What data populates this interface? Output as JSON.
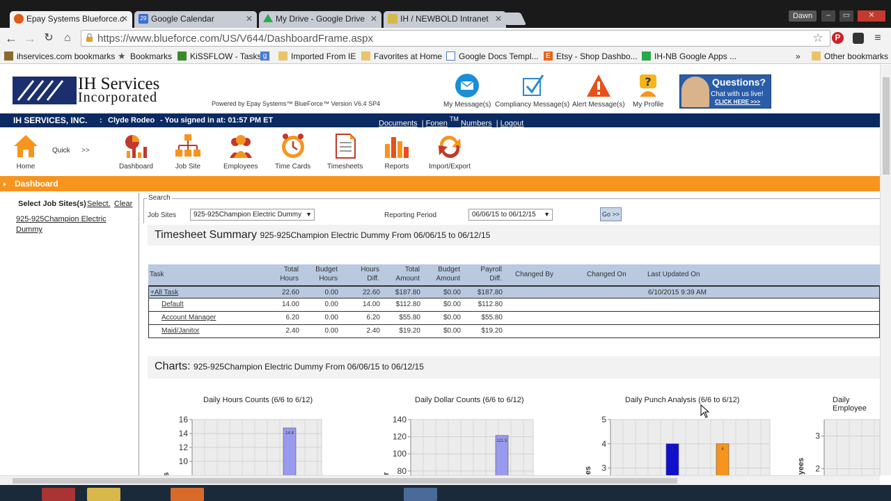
{
  "browser": {
    "tabs": [
      {
        "title": "Epay Systems Blueforce.c",
        "active": true,
        "favicon_color": "#e05a1c"
      },
      {
        "title": "Google Calendar",
        "active": false,
        "favicon_color": "#3b6fd6",
        "favicon_text": "29"
      },
      {
        "title": "My Drive - Google Drive",
        "active": false,
        "favicon_color": "#2aa84a"
      },
      {
        "title": "IH / NEWBOLD Intranet",
        "active": false,
        "favicon_color": "#d4b84a"
      }
    ],
    "user_badge": "Dawn",
    "window_buttons": [
      "–",
      "▭",
      "✕"
    ],
    "url": "https://www.blueforce.com/US/V644/DashboardFrame.aspx",
    "bookmarks": [
      {
        "label": "ihservices.com bookmarks",
        "icon": "apps-icon"
      },
      {
        "label": "Bookmarks",
        "icon": "star-icon"
      },
      {
        "label": "KiSSFLOW - Tasks",
        "icon": "kissflow-icon"
      },
      {
        "label": "",
        "icon": "google-icon"
      },
      {
        "label": "Imported From IE",
        "icon": "folder-icon"
      },
      {
        "label": "Favorites at Home",
        "icon": "folder-icon"
      },
      {
        "label": "Google Docs Templ...",
        "icon": "doc-icon"
      },
      {
        "label": "Etsy - Shop Dashbo...",
        "icon": "etsy-icon"
      },
      {
        "label": "IH-NB Google Apps ...",
        "icon": "sheets-icon"
      }
    ],
    "bookmarks_overflow": "»",
    "other_bookmarks": "Other bookmarks"
  },
  "header": {
    "logo_line1": "IH Services",
    "logo_line2": "Incorporated",
    "powered_by": "Powered by Epay Systems™ BlueForce™ Version V6.4 SP4",
    "top_icons": [
      {
        "label": "My Message(s)",
        "icon": "envelope-icon"
      },
      {
        "label": "Compliancy Message(s)",
        "icon": "checkbox-icon"
      },
      {
        "label": "Alert Message(s)",
        "icon": "warning-icon"
      },
      {
        "label": "My Profile",
        "icon": "profile-icon"
      }
    ],
    "questions": {
      "title": "Questions?",
      "line2": "Chat with us live!",
      "line3": "CLICK HERE >>>"
    }
  },
  "bluebar": {
    "company": "IH SERVICES, INC.",
    "sep": ":",
    "user": "Clyde Rodeo",
    "signin": "-   You signed in at: 01:57 PM ET",
    "links": [
      "Documents",
      "Fonen",
      "Numbers",
      "Logout"
    ],
    "tm": "TM"
  },
  "nav": {
    "home": "Home",
    "quick": "Quick",
    "quick_arrow": ">>",
    "items": [
      {
        "label": "Dashboard",
        "icon": "dashboard-icon"
      },
      {
        "label": "Job Site",
        "icon": "jobsite-icon"
      },
      {
        "label": "Employees",
        "icon": "employees-icon"
      },
      {
        "label": "Time Cards",
        "icon": "clock-icon"
      },
      {
        "label": "Timesheets",
        "icon": "timesheet-icon"
      },
      {
        "label": "Reports",
        "icon": "reports-icon"
      },
      {
        "label": "Import/Export",
        "icon": "import-export-icon"
      }
    ]
  },
  "section_title": "Dashboard",
  "left": {
    "label": "Select Job Sites(s)",
    "select": "Select.",
    "clear": "Clear",
    "site": "925-925Champion Electric Dummy"
  },
  "search": {
    "legend": "Search",
    "jobsites_label": "Job Sites",
    "jobsites_value": "925-925Champion Electric Dummy",
    "period_label": "Reporting Period",
    "period_value": "06/06/15 to 06/12/15",
    "go": "Go >>"
  },
  "summary": {
    "title": "Timesheet Summary",
    "subtitle": "925-925Champion Electric Dummy From 06/06/15 to 06/12/15",
    "columns": [
      {
        "l1": "Task",
        "l2": ""
      },
      {
        "l1": "Total",
        "l2": "Hours"
      },
      {
        "l1": "Budget",
        "l2": "Hours"
      },
      {
        "l1": "Hours",
        "l2": "Diff."
      },
      {
        "l1": "Total",
        "l2": "Amount"
      },
      {
        "l1": "Budget",
        "l2": "Amount"
      },
      {
        "l1": "Payroll",
        "l2": "Diff."
      },
      {
        "l1": "Changed By",
        "l2": ""
      },
      {
        "l1": "Changed On",
        "l2": ""
      },
      {
        "l1": "Last Updated On",
        "l2": ""
      }
    ],
    "rows": [
      {
        "task": "+All Task",
        "total_hours": "22.60",
        "budget_hours": "0.00",
        "hours_diff": "22.60",
        "total_amount": "$187.80",
        "budget_amount": "$0.00",
        "payroll_diff": "$187.80",
        "changed_by": "",
        "changed_on": "",
        "last_updated": "6/10/2015 9:39 AM"
      },
      {
        "task": "Default",
        "total_hours": "14.00",
        "budget_hours": "0.00",
        "hours_diff": "14.00",
        "total_amount": "$112.80",
        "budget_amount": "$0.00",
        "payroll_diff": "$112.80",
        "changed_by": "",
        "changed_on": "",
        "last_updated": ""
      },
      {
        "task": "Account Manager",
        "total_hours": "6.20",
        "budget_hours": "0.00",
        "hours_diff": "6.20",
        "total_amount": "$55.80",
        "budget_amount": "$0.00",
        "payroll_diff": "$55.80",
        "changed_by": "",
        "changed_on": "",
        "last_updated": ""
      },
      {
        "task": "Maid/Janitor",
        "total_hours": "2.40",
        "budget_hours": "0.00",
        "hours_diff": "2.40",
        "total_amount": "$19.20",
        "budget_amount": "$0.00",
        "payroll_diff": "$19.20",
        "changed_by": "",
        "changed_on": "",
        "last_updated": ""
      }
    ]
  },
  "charts_header": {
    "title": "Charts:",
    "subtitle": "925-925Champion Electric Dummy From 06/06/15 to 06/12/15"
  },
  "chart_data": [
    {
      "type": "bar",
      "title": "Daily Hours Counts (6/6 to 6/12)",
      "ylabel_fragment": "rs",
      "yticks": [
        10,
        12,
        14,
        16
      ],
      "ylim": [
        8,
        16
      ],
      "bars": [
        {
          "value": 14.8,
          "label": "14.8",
          "color": "#9999ee"
        }
      ],
      "grid": true
    },
    {
      "type": "bar",
      "title": "Daily Dollar Counts (6/6 to 6/12)",
      "ylabel_fragment": "ar",
      "yticks": [
        80,
        100,
        120,
        140
      ],
      "ylim": [
        75,
        140
      ],
      "bars": [
        {
          "value": 121.5,
          "label": "121.5",
          "color": "#9999ee"
        }
      ],
      "grid": true
    },
    {
      "type": "bar",
      "title": "Daily Punch Analysis (6/6 to 6/12)",
      "ylabel_fragment": "nes",
      "yticks": [
        3,
        4,
        5
      ],
      "ylim": [
        2.7,
        5
      ],
      "bars": [
        {
          "value": 4,
          "label": "4",
          "color": "#1010cc"
        },
        {
          "value": 4,
          "label": "4",
          "color": "#f7941d"
        }
      ],
      "grid": true
    },
    {
      "type": "bar",
      "title": "Daily Employee",
      "ylabel_fragment": "oyees",
      "yticks": [
        2,
        3
      ],
      "ylim": [
        1.8,
        3.5
      ],
      "bars": [],
      "grid": true
    }
  ]
}
